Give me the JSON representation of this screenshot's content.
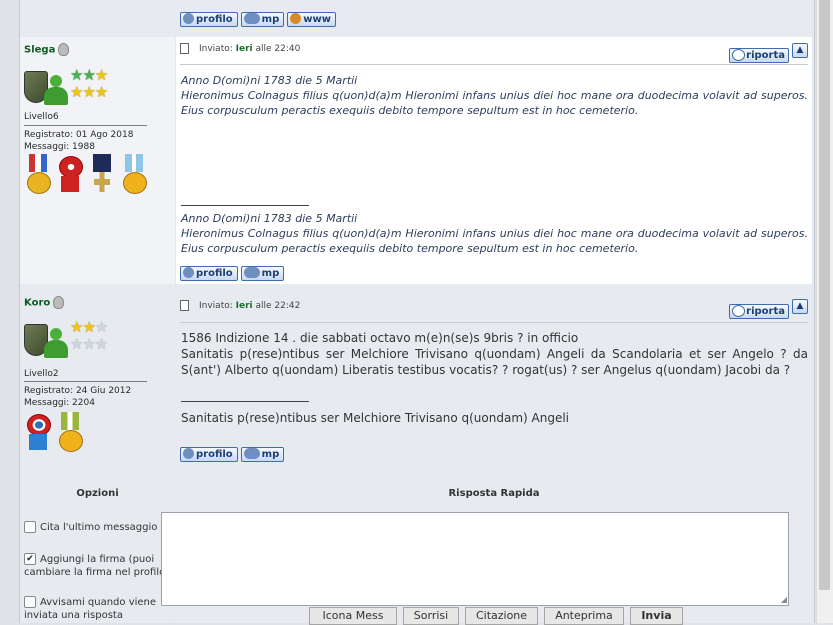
{
  "top_buttons": {
    "profile": "profilo",
    "pm": "mp",
    "www": "www"
  },
  "posts": [
    {
      "username": "Slega",
      "level": "Livello6",
      "registered": "Registrato: 01 Ago 2018",
      "messages": "Messaggi: 1988",
      "sent_label": "Inviato:",
      "sent_day": "Ieri",
      "sent_time": "alle 22:40",
      "quote_label": "riporta",
      "up_label": "▲",
      "body": [
        "Anno D(omi)ni 1783 die 5 Martii",
        "Hieronimus Colnagus filius q(uon)d(a)m Hieronimi infans unius diei hoc mane ora duodecima volavit ad superos. Eius corpusculum peractis exequiis debito tempore sepultum est in hoc cemeterio."
      ],
      "signature": [
        "Anno D(omi)ni 1783 die 5 Martii",
        "Hieronimus Colnagus filius q(uon)d(a)m Hieronimi infans unius diei hoc mane ora duodecima volavit ad superos. Eius corpusculum peractis exequiis debito tempore sepultum est in hoc cemeterio."
      ],
      "stars": 6,
      "buttons": [
        "profilo",
        "mp"
      ]
    },
    {
      "username": "Koro",
      "level": "Livello2",
      "registered": "Registrato: 24 Giu 2012",
      "messages": "Messaggi: 2204",
      "sent_label": "Inviato:",
      "sent_day": "Ieri",
      "sent_time": "alle 22:42",
      "quote_label": "riporta",
      "up_label": "▲",
      "body": [
        "1586 Indizione 14 . die sabbati octavo m(e)n(se)s 9bris ? in officio",
        "Sanitatis p(rese)ntibus ser Melchiore Trivisano q(uondam) Angeli da Scandolaria et ser Angelo ? da S(ant') Alberto q(uondam) Liberatis testibus vocatis? ? rogat(us) ? ser Angelus q(uondam) Jacobi da ?"
      ],
      "signature": [
        "Sanitatis p(rese)ntibus ser Melchiore Trivisano q(uondam) Angeli"
      ],
      "stars": 2,
      "buttons": [
        "profilo",
        "mp"
      ]
    }
  ],
  "quick_reply": {
    "options_title": "Opzioni",
    "title": "Risposta Rapida",
    "options": [
      {
        "label": "Cita l'ultimo messaggio",
        "checked": false
      },
      {
        "label": "Aggiungi la firma (puoi cambiare la firma nel profilo)",
        "checked": true
      },
      {
        "label": "Avvisami quando viene inviata una risposta",
        "checked": false
      }
    ],
    "buttons": [
      "Icona Mess",
      "Sorrisi",
      "Citazione",
      "Anteprima",
      "Invia"
    ]
  }
}
